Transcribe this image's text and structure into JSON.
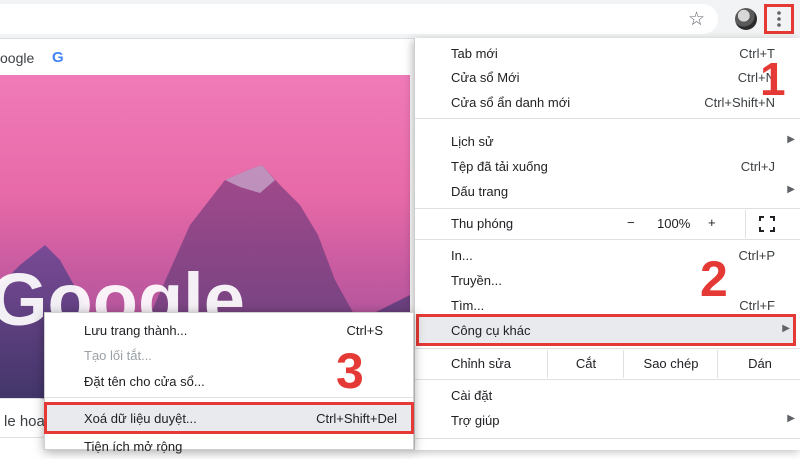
{
  "toolbar": {
    "star_icon": "star-icon",
    "menu_icon": "more-vert-icon"
  },
  "ntp": {
    "link_text": "oogle",
    "google_icon_letter": "G",
    "logo_text": "Google",
    "search_stub": "le hoa"
  },
  "menu": {
    "items": [
      {
        "label": "Tab mới",
        "shortcut": "Ctrl+T"
      },
      {
        "label": "Cửa sổ Mới",
        "shortcut": "Ctrl+N"
      },
      {
        "label": "Cửa sổ ẩn danh mới",
        "shortcut": "Ctrl+Shift+N"
      },
      {
        "label": "Lịch sử",
        "shortcut": ""
      },
      {
        "label": "Tệp đã tải xuống",
        "shortcut": "Ctrl+J"
      },
      {
        "label": "Dấu trang",
        "shortcut": ""
      },
      {
        "label": "In...",
        "shortcut": "Ctrl+P"
      },
      {
        "label": "Truyền...",
        "shortcut": ""
      },
      {
        "label": "Tìm...",
        "shortcut": "Ctrl+F"
      },
      {
        "label": "Cài đặt",
        "shortcut": ""
      },
      {
        "label": "Trợ giúp",
        "shortcut": ""
      }
    ],
    "zoom": {
      "label": "Thu phóng",
      "minus": "−",
      "value": "100%",
      "plus": "+"
    },
    "more_tools": {
      "label": "Công cụ khác"
    },
    "edit": {
      "label": "Chỉnh sửa",
      "cut": "Cắt",
      "copy": "Sao chép",
      "paste": "Dán"
    }
  },
  "submenu": {
    "items": [
      {
        "label": "Lưu trang thành...",
        "shortcut": "Ctrl+S"
      },
      {
        "label": "Tạo lối tắt...",
        "shortcut": ""
      },
      {
        "label": "Đặt tên cho cửa sổ...",
        "shortcut": ""
      },
      {
        "label": "Xoá dữ liệu duyệt...",
        "shortcut": "Ctrl+Shift+Del"
      },
      {
        "label": "Tiện ích mở rộng",
        "shortcut": ""
      }
    ]
  },
  "annotations": {
    "step1": "1",
    "step2": "2",
    "step3": "3",
    "color": "#e53935"
  }
}
